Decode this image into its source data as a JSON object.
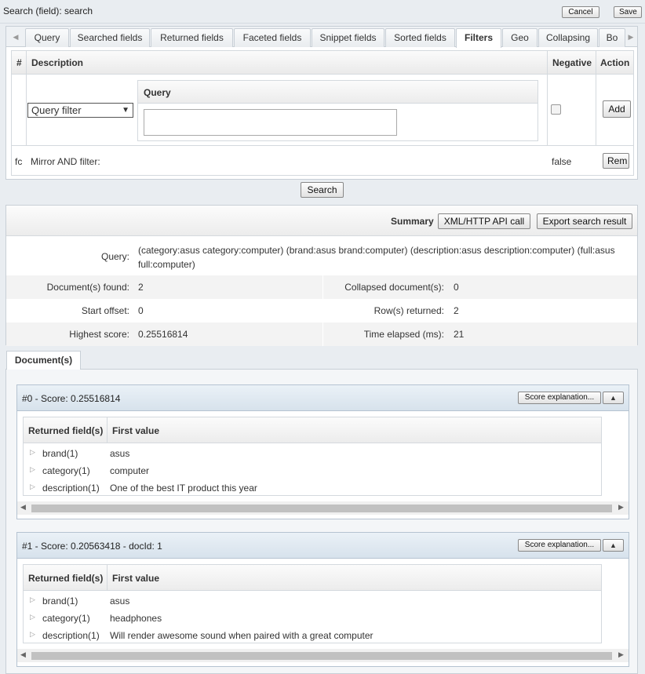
{
  "window": {
    "title": "Search (field): search",
    "cancel_label": "Cancel",
    "save_label": "Save"
  },
  "tabs": [
    {
      "label": "Query"
    },
    {
      "label": "Searched fields"
    },
    {
      "label": "Returned fields"
    },
    {
      "label": "Faceted fields"
    },
    {
      "label": "Snippet fields"
    },
    {
      "label": "Sorted fields"
    },
    {
      "label": "Filters"
    },
    {
      "label": "Geo"
    },
    {
      "label": "Collapsing"
    },
    {
      "label": "Bo"
    }
  ],
  "active_tab": "Filters",
  "filters": {
    "headers": {
      "num": "#",
      "description": "Description",
      "negative": "Negative",
      "action": "Action"
    },
    "select_value": "Query filter",
    "query_header": "Query",
    "query_value": "",
    "negative_checked": false,
    "add_label": "Add",
    "mirror": {
      "num": "fc",
      "description": "Mirror AND filter:",
      "negative": "false",
      "action_label": "Rem"
    }
  },
  "search_label": "Search",
  "summary": {
    "label": "Summary",
    "xml_label": "XML/HTTP API call",
    "export_label": "Export search result",
    "query_key": "Query:",
    "query_value": "(category:asus category:computer) (brand:asus brand:computer) (description:asus description:computer) (full:asus full:computer)",
    "docs_found_key": "Document(s) found:",
    "docs_found_value": "2",
    "collapsed_key": "Collapsed document(s):",
    "collapsed_value": "0",
    "start_offset_key": "Start offset:",
    "start_offset_value": "0",
    "rows_returned_key": "Row(s) returned:",
    "rows_returned_value": "2",
    "highest_score_key": "Highest score:",
    "highest_score_value": "0.25516814",
    "time_key": "Time elapsed (ms):",
    "time_value": "21"
  },
  "documents": {
    "tab_label": "Document(s)",
    "score_btn_label": "Score explanation...",
    "col_field": "Returned field(s)",
    "col_value": "First value",
    "results": [
      {
        "title": "#0 - Score: 0.25516814",
        "rows": [
          {
            "field": "brand(1)",
            "value": "asus"
          },
          {
            "field": "category(1)",
            "value": "computer"
          },
          {
            "field": "description(1)",
            "value": "One of the best IT product this year"
          }
        ]
      },
      {
        "title": "#1 - Score: 0.20563418 - docId: 1",
        "rows": [
          {
            "field": "brand(1)",
            "value": "asus"
          },
          {
            "field": "category(1)",
            "value": "headphones"
          },
          {
            "field": "description(1)",
            "value": "Will render awesome sound when paired with a great computer"
          }
        ]
      }
    ]
  }
}
